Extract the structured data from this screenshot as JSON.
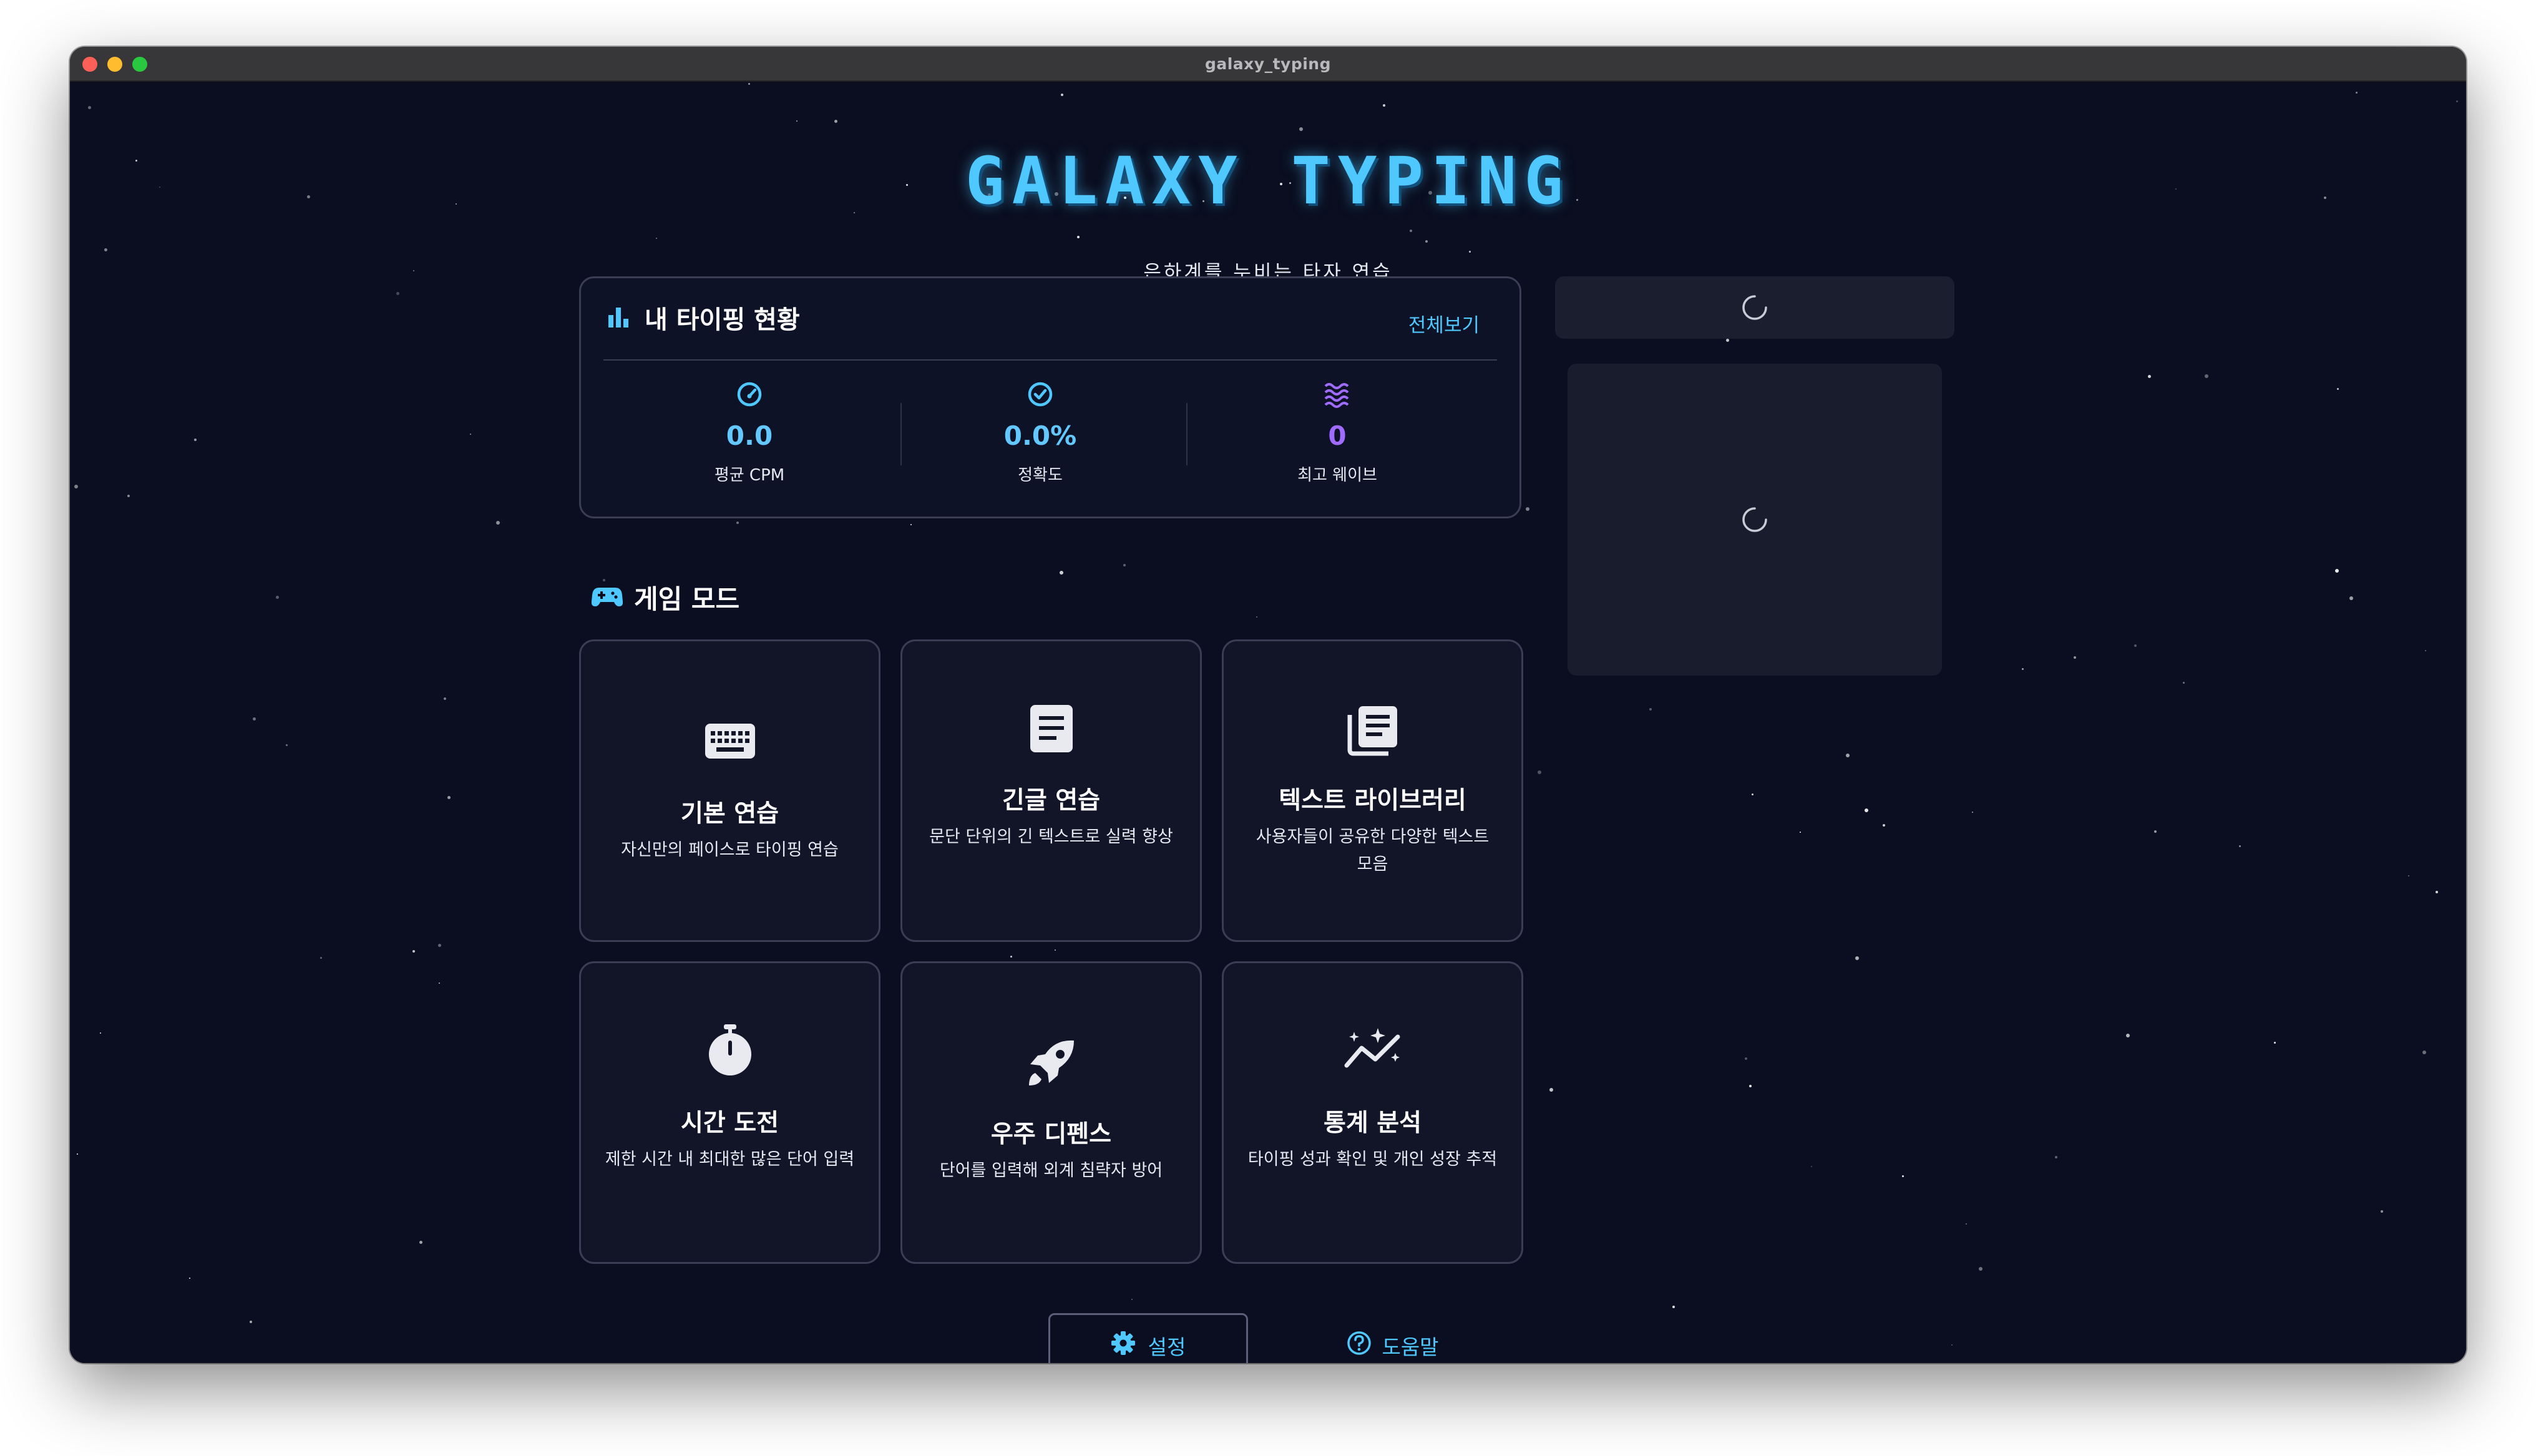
{
  "window": {
    "title": "galaxy_typing"
  },
  "header": {
    "logo": "GALAXY TYPING",
    "subtitle": "은하계를 누비는 타자 연습"
  },
  "stats": {
    "title": "내 타이핑 현황",
    "see_all": "전체보기",
    "items": [
      {
        "icon": "speedometer-icon",
        "value": "0.0",
        "label": "평균 CPM"
      },
      {
        "icon": "check-circle-icon",
        "value": "0.0%",
        "label": "정확도"
      },
      {
        "icon": "wave-icon",
        "value": "0",
        "label": "최고 웨이브"
      }
    ]
  },
  "modes": {
    "title": "게임 모드",
    "items": [
      {
        "icon": "keyboard-icon",
        "title": "기본 연습",
        "desc": "자신만의 페이스로 타이핑 연습"
      },
      {
        "icon": "document-icon",
        "title": "긴글 연습",
        "desc": "문단 단위의 긴 텍스트로 실력 향상"
      },
      {
        "icon": "library-icon",
        "title": "텍스트 라이브러리",
        "desc": "사용자들이 공유한 다양한 텍스트 모음"
      },
      {
        "icon": "stopwatch-icon",
        "title": "시간 도전",
        "desc": "제한 시간 내 최대한 많은 단어 입력"
      },
      {
        "icon": "rocket-icon",
        "title": "우주 디펜스",
        "desc": "단어를 입력해 외계 침략자 방어"
      },
      {
        "icon": "chart-sparkle-icon",
        "title": "통계 분석",
        "desc": "타이핑 성과 확인 및 개인 성장 추적"
      }
    ]
  },
  "footer": {
    "settings": "설정",
    "help": "도움말"
  },
  "colors": {
    "accent": "#4fc8ff",
    "purple": "#a06bff",
    "background": "#0a0e20"
  }
}
